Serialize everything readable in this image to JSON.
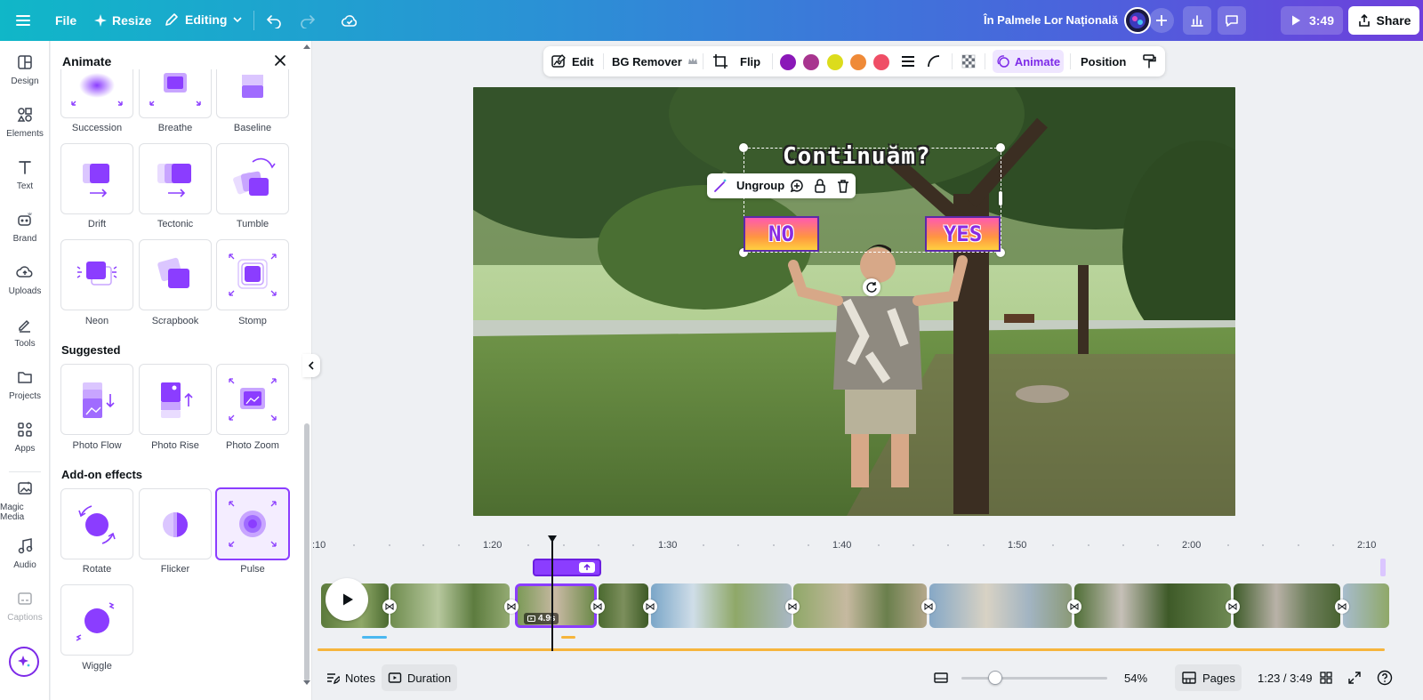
{
  "topbar": {
    "file_label": "File",
    "resize_label": "Resize",
    "editing_label": "Editing",
    "project_title": "În Palmele Lor Națională",
    "play_time": "3:49",
    "share_label": "Share"
  },
  "rail": {
    "items": [
      {
        "label": "Design",
        "icon": "design-icon"
      },
      {
        "label": "Elements",
        "icon": "elements-icon"
      },
      {
        "label": "Text",
        "icon": "text-icon"
      },
      {
        "label": "Brand",
        "icon": "brand-icon"
      },
      {
        "label": "Uploads",
        "icon": "uploads-icon"
      },
      {
        "label": "Tools",
        "icon": "tools-icon"
      },
      {
        "label": "Projects",
        "icon": "projects-icon"
      },
      {
        "label": "Apps",
        "icon": "apps-icon"
      },
      {
        "label": "Magic Media",
        "icon": "magic-media-icon"
      },
      {
        "label": "Audio",
        "icon": "audio-icon"
      },
      {
        "label": "Captions",
        "icon": "captions-icon"
      }
    ]
  },
  "panel": {
    "title": "Animate",
    "row1": [
      "Succession",
      "Breathe",
      "Baseline"
    ],
    "row2": [
      "Drift",
      "Tectonic",
      "Tumble"
    ],
    "row3": [
      "Neon",
      "Scrapbook",
      "Stomp"
    ],
    "suggested_title": "Suggested",
    "suggested": [
      "Photo Flow",
      "Photo Rise",
      "Photo Zoom"
    ],
    "addon_title": "Add-on effects",
    "addon": [
      "Rotate",
      "Flicker",
      "Pulse"
    ],
    "addon2": [
      "Wiggle"
    ],
    "selected_effect": "Pulse"
  },
  "context_toolbar": {
    "edit_label": "Edit",
    "bg_remover_label": "BG Remover",
    "flip_label": "Flip",
    "colors": [
      "#8a18b8",
      "#a8358f",
      "#dcdc1c",
      "#ef8a38",
      "#ef4e66"
    ],
    "animate_label": "Animate",
    "position_label": "Position"
  },
  "canvas": {
    "overlay_title": "Continuăm?",
    "no_label": "NO",
    "yes_label": "YES",
    "ungroup_label": "Ungroup"
  },
  "timeline": {
    "ruler": [
      ":10",
      "1:20",
      "1:30",
      "1:40",
      "1:50",
      "2:00",
      "2:10"
    ],
    "selected_clip_duration": "4.9s"
  },
  "bottombar": {
    "notes_label": "Notes",
    "duration_label": "Duration",
    "zoom": "54%",
    "zoom_level": 0.54,
    "pages_label": "Pages",
    "time_position": "1:23 / 3:49"
  }
}
